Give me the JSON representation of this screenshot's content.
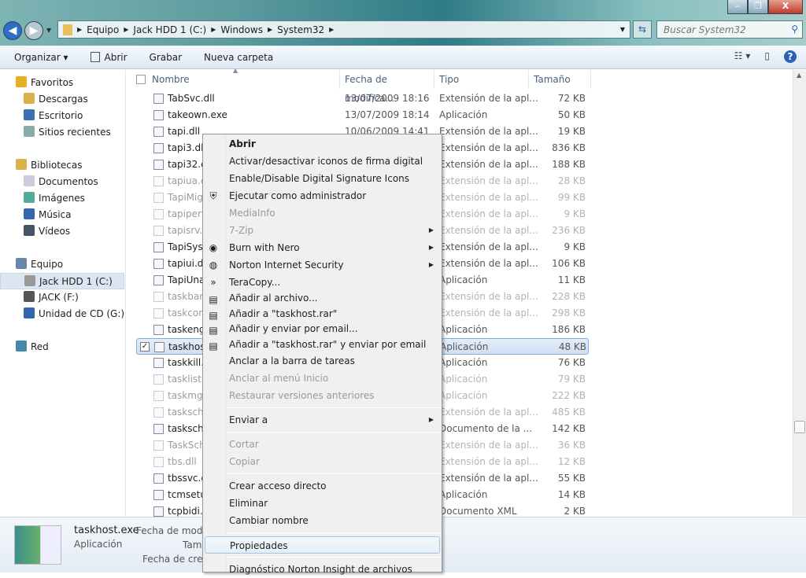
{
  "window": {
    "minimize": "‒",
    "maximize": "❐",
    "close": "X"
  },
  "address": {
    "crumbs": [
      "Equipo",
      "Jack HDD 1 (C:)",
      "Windows",
      "System32"
    ],
    "search_placeholder": "Buscar System32"
  },
  "toolbar": {
    "organize": "Organizar ▾",
    "open": "Abrir",
    "burn": "Grabar",
    "new_folder": "Nueva carpeta"
  },
  "nav": [
    {
      "label": "Favoritos",
      "icon": "star-icon",
      "color": "#e8b020",
      "group": true
    },
    {
      "label": "Descargas",
      "icon": "folder-icon",
      "color": "#d9b24a"
    },
    {
      "label": "Escritorio",
      "icon": "desktop-icon",
      "color": "#3a6fb0"
    },
    {
      "label": "Sitios recientes",
      "icon": "recent-icon",
      "color": "#8aa"
    },
    {
      "label": "Bibliotecas",
      "icon": "library-icon",
      "color": "#d9b24a",
      "group": true
    },
    {
      "label": "Documentos",
      "icon": "document-icon",
      "color": "#ccd"
    },
    {
      "label": "Imágenes",
      "icon": "pictures-icon",
      "color": "#5a9"
    },
    {
      "label": "Música",
      "icon": "music-icon",
      "color": "#36a"
    },
    {
      "label": "Vídeos",
      "icon": "video-icon",
      "color": "#456"
    },
    {
      "label": "Equipo",
      "icon": "computer-icon",
      "color": "#68a",
      "group": true
    },
    {
      "label": "Jack HDD 1 (C:)",
      "icon": "drive-icon",
      "color": "#999",
      "selected": true
    },
    {
      "label": "JACK (F:)",
      "icon": "usb-drive-icon",
      "color": "#555"
    },
    {
      "label": "Unidad de CD (G:) Ir",
      "icon": "cd-drive-icon",
      "color": "#36a"
    },
    {
      "label": "Red",
      "icon": "network-icon",
      "color": "#48a",
      "group": true
    }
  ],
  "columns": {
    "name": "Nombre",
    "date": "Fecha de modifica...",
    "type": "Tipo",
    "size": "Tamaño"
  },
  "files": [
    {
      "name": "TabSvc.dll",
      "date": "13/07/2009 18:16",
      "type": "Extensión de la apl...",
      "size": "72 KB"
    },
    {
      "name": "takeown.exe",
      "date": "13/07/2009 18:14",
      "type": "Aplicación",
      "size": "50 KB"
    },
    {
      "name": "tapi.dll",
      "date": "10/06/2009 14:41",
      "type": "Extensión de la apl...",
      "size": "19 KB"
    },
    {
      "name": "tapi3.dll",
      "type": "Extensión de la apl...",
      "size": "836 KB"
    },
    {
      "name": "tapi32.d",
      "type": "Extensión de la apl...",
      "size": "188 KB"
    },
    {
      "name": "tapiua.c",
      "type": "Extensión de la apl...",
      "size": "28 KB",
      "faded": true
    },
    {
      "name": "TapiMig",
      "type": "Extensión de la apl...",
      "size": "99 KB",
      "faded": true
    },
    {
      "name": "tapiperf.",
      "type": "Extensión de la apl...",
      "size": "9 KB",
      "faded": true
    },
    {
      "name": "tapisrv.c",
      "type": "Extensión de la apl...",
      "size": "236 KB",
      "faded": true
    },
    {
      "name": "TapiSysp",
      "type": "Extensión de la apl...",
      "size": "9 KB"
    },
    {
      "name": "tapiui.dll",
      "type": "Extensión de la apl...",
      "size": "106 KB"
    },
    {
      "name": "TapiUna",
      "type": "Aplicación",
      "size": "11 KB"
    },
    {
      "name": "taskbarc",
      "type": "Extensión de la apl...",
      "size": "228 KB",
      "faded": true
    },
    {
      "name": "taskcom",
      "type": "Extensión de la apl...",
      "size": "298 KB",
      "faded": true
    },
    {
      "name": "taskeng.",
      "type": "Aplicación",
      "size": "186 KB"
    },
    {
      "name": "taskhost",
      "type": "Aplicación",
      "size": "48 KB",
      "selected": true
    },
    {
      "name": "taskkill.e",
      "type": "Aplicación",
      "size": "76 KB"
    },
    {
      "name": "tasklist.e",
      "type": "Aplicación",
      "size": "79 KB",
      "faded": true
    },
    {
      "name": "taskmgr",
      "type": "Aplicación",
      "size": "222 KB",
      "faded": true
    },
    {
      "name": "taskschd",
      "type": "Extensión de la apl...",
      "size": "485 KB",
      "faded": true
    },
    {
      "name": "tasksch",
      "type": "Documento de la ...",
      "size": "142 KB"
    },
    {
      "name": "TaskSch",
      "type": "Extensión de la apl...",
      "size": "36 KB",
      "faded": true
    },
    {
      "name": "tbs.dll",
      "type": "Extensión de la apl...",
      "size": "12 KB",
      "faded": true
    },
    {
      "name": "tbssvc.d",
      "type": "Extensión de la apl...",
      "size": "55 KB"
    },
    {
      "name": "tcmsetu",
      "type": "Aplicación",
      "size": "14 KB"
    },
    {
      "name": "tcpbidi.x",
      "type": "Documento XML",
      "size": "2 KB"
    }
  ],
  "details": {
    "name": "taskhost.exe",
    "type": "Aplicación",
    "label_modified": "Fecha de modif",
    "label_size": "Tam",
    "label_created": "Fecha de creac"
  },
  "menu": [
    {
      "label": "Abrir",
      "bold": true
    },
    {
      "label": "Activar/desactivar iconos de firma digital"
    },
    {
      "label": "Enable/Disable Digital Signature Icons"
    },
    {
      "label": "Ejecutar como administrador",
      "icon": "uac-shield-icon",
      "glyph": "⛨"
    },
    {
      "label": "MediaInfo",
      "disabled": true
    },
    {
      "label": "7-Zip",
      "submenu": true,
      "disabled": true
    },
    {
      "label": "Burn with Nero",
      "submenu": true,
      "icon": "nero-icon",
      "glyph": "◉"
    },
    {
      "label": "Norton Internet Security",
      "submenu": true,
      "icon": "norton-icon",
      "glyph": "◍"
    },
    {
      "label": "TeraCopy...",
      "icon": "teracopy-icon",
      "glyph": "»"
    },
    {
      "label": "Añadir al archivo...",
      "icon": "winrar-icon",
      "glyph": "▤",
      "short": true
    },
    {
      "label": "Añadir a \"taskhost.rar\"",
      "icon": "winrar-icon",
      "glyph": "▤",
      "short": true
    },
    {
      "label": "Añadir y enviar por email...",
      "icon": "winrar-icon",
      "glyph": "▤",
      "short": true
    },
    {
      "label": "Añadir a \"taskhost.rar\" y enviar por email",
      "icon": "winrar-icon",
      "glyph": "▤",
      "short": true
    },
    {
      "label": "Anclar a la barra de tareas"
    },
    {
      "label": "Anclar al menú Inicio",
      "disabled": true
    },
    {
      "label": "Restaurar versiones anteriores",
      "disabled": true
    },
    {
      "sep": true
    },
    {
      "label": "Enviar a",
      "submenu": true
    },
    {
      "sep": true
    },
    {
      "label": "Cortar",
      "disabled": true
    },
    {
      "label": "Copiar",
      "disabled": true
    },
    {
      "sep": true
    },
    {
      "label": "Crear acceso directo"
    },
    {
      "label": "Eliminar"
    },
    {
      "label": "Cambiar nombre"
    },
    {
      "sep": true
    },
    {
      "label": "Propiedades",
      "hover": true
    },
    {
      "sep": true
    },
    {
      "label": "Diagnóstico Norton Insight de archivos"
    }
  ]
}
